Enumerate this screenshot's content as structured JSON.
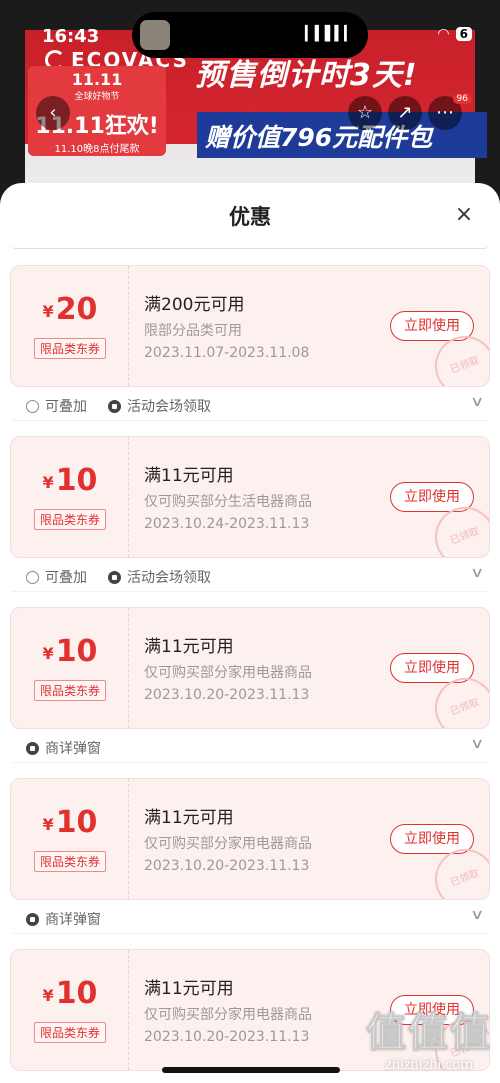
{
  "status_bar": {
    "time": "16:43",
    "wave_icon": "waveform-icon",
    "wifi_icon": "wifi-icon",
    "battery": "6"
  },
  "product_bg": {
    "brand": "ECOVACS",
    "headline": "预售倒计时3天!",
    "gift_line": "赠价值796元配件包",
    "promo": {
      "line1": "11.11",
      "line2": "全球好物节",
      "line3": "11.11狂欢!",
      "line4": "11.10晚8点付尾款"
    },
    "back_icon": "chevron-left-icon",
    "favorite_icon": "star-icon",
    "share_icon": "share-icon",
    "more_icon": "more-icon",
    "cart_count": "96"
  },
  "sheet": {
    "title": "优惠",
    "close_label": "×",
    "coupons": [
      {
        "currency": "¥",
        "amount": "20",
        "tag": "限品类东券",
        "title": "满200元可用",
        "desc": "限部分品类可用",
        "date": "2023.11.07-2023.11.08",
        "button": "立即使用",
        "stamp": "已领取",
        "features": [
          "可叠加",
          "活动会场领取"
        ]
      },
      {
        "currency": "¥",
        "amount": "10",
        "tag": "限品类东券",
        "title": "满11元可用",
        "desc": "仅可购买部分生活电器商品",
        "date": "2023.10.24-2023.11.13",
        "button": "立即使用",
        "stamp": "已领取",
        "features": [
          "可叠加",
          "活动会场领取"
        ]
      },
      {
        "currency": "¥",
        "amount": "10",
        "tag": "限品类东券",
        "title": "满11元可用",
        "desc": "仅可购买部分家用电器商品",
        "date": "2023.10.20-2023.11.13",
        "button": "立即使用",
        "stamp": "已领取",
        "features": [
          "商详弹窗"
        ]
      },
      {
        "currency": "¥",
        "amount": "10",
        "tag": "限品类东券",
        "title": "满11元可用",
        "desc": "仅可购买部分家用电器商品",
        "date": "2023.10.20-2023.11.13",
        "button": "立即使用",
        "stamp": "已领取",
        "features": [
          "商详弹窗"
        ]
      },
      {
        "currency": "¥",
        "amount": "10",
        "tag": "限品类东券",
        "title": "满11元可用",
        "desc": "仅可购买部分家用电器商品",
        "date": "2023.10.20-2023.11.13",
        "button": "立即使用",
        "stamp": "已领取",
        "features": []
      }
    ]
  },
  "watermark": {
    "big": "值值值",
    "small": "zhizhizhi.com"
  }
}
